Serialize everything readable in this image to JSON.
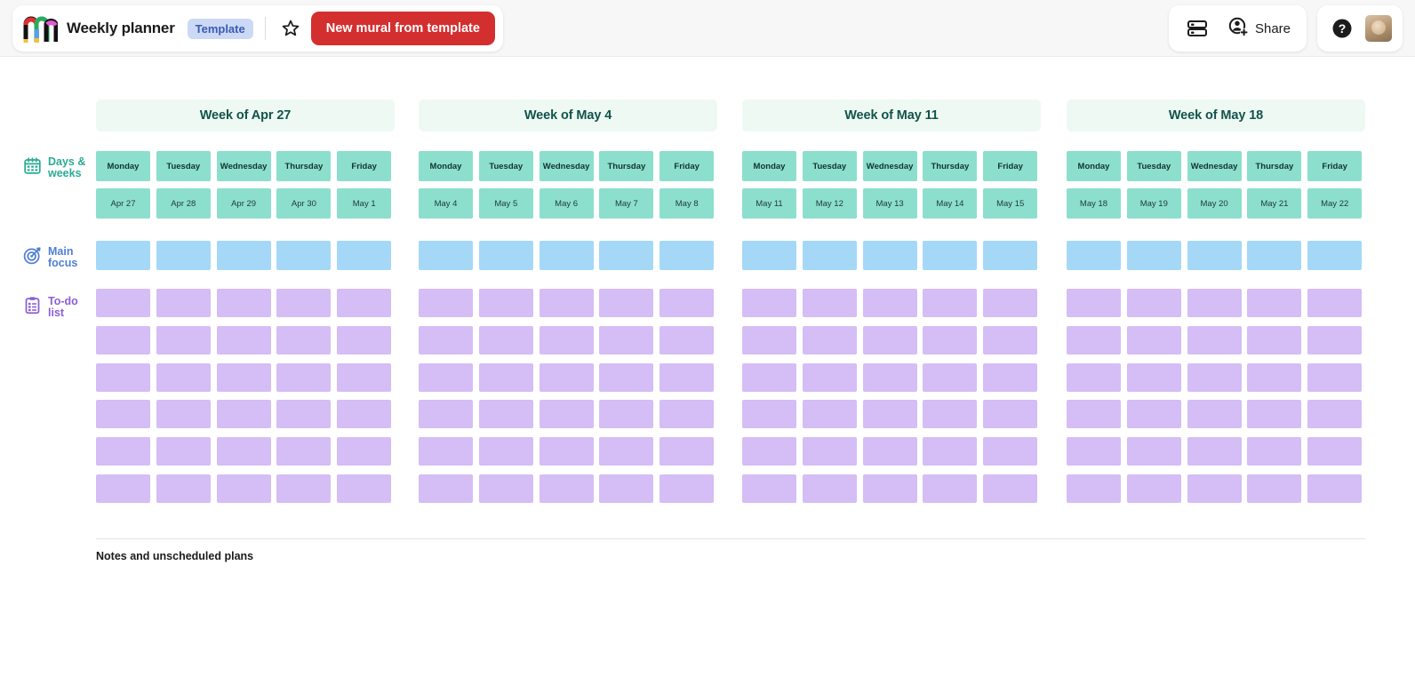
{
  "topbar": {
    "logo_name": "mural-logo",
    "doc_title": "Weekly planner",
    "template_badge": "Template",
    "star_label": "Favorite",
    "new_mural_button": "New mural from template",
    "outline_label": "Outline",
    "share_label": "Share",
    "help_label": "Help",
    "avatar_label": "Account"
  },
  "colors": {
    "brand_red": "#d32f2f",
    "badge_bg": "#ccd9f5",
    "badge_text": "#3a5bb0",
    "week_header_bg": "#eef9f4",
    "week_header_text": "#12534a",
    "teal": "#8ddfcd",
    "blue": "#a5d8f7",
    "purple": "#d5bdf5"
  },
  "rows": [
    {
      "id": "days-weeks",
      "label": "Days & weeks",
      "line1": "Days &",
      "line2": "weeks",
      "icon": "calendar-icon",
      "color": "#2bab95"
    },
    {
      "id": "main-focus",
      "label": "Main focus",
      "line1": "Main",
      "line2": "focus",
      "icon": "target-icon",
      "color": "#4f7fd4"
    },
    {
      "id": "to-do-list",
      "label": "To-do list",
      "line1": "To-do",
      "line2": "list",
      "icon": "clipboard-icon",
      "color": "#8b5fd6"
    }
  ],
  "day_names": [
    "Monday",
    "Tuesday",
    "Wednesday",
    "Thursday",
    "Friday"
  ],
  "weeks": [
    {
      "header": "Week of Apr 27",
      "dates": [
        "Apr 27",
        "Apr 28",
        "Apr 29",
        "Apr 30",
        "May 1"
      ]
    },
    {
      "header": "Week of May 4",
      "dates": [
        "May 4",
        "May 5",
        "May 6",
        "May 7",
        "May 8"
      ]
    },
    {
      "header": "Week of May 11",
      "dates": [
        "May 11",
        "May 12",
        "May 13",
        "May 14",
        "May 15"
      ]
    },
    {
      "header": "Week of May 18",
      "dates": [
        "May 18",
        "May 19",
        "May 20",
        "May 21",
        "May 22"
      ]
    }
  ],
  "todo_rows": 6,
  "notes": {
    "label": "Notes and unscheduled plans"
  }
}
